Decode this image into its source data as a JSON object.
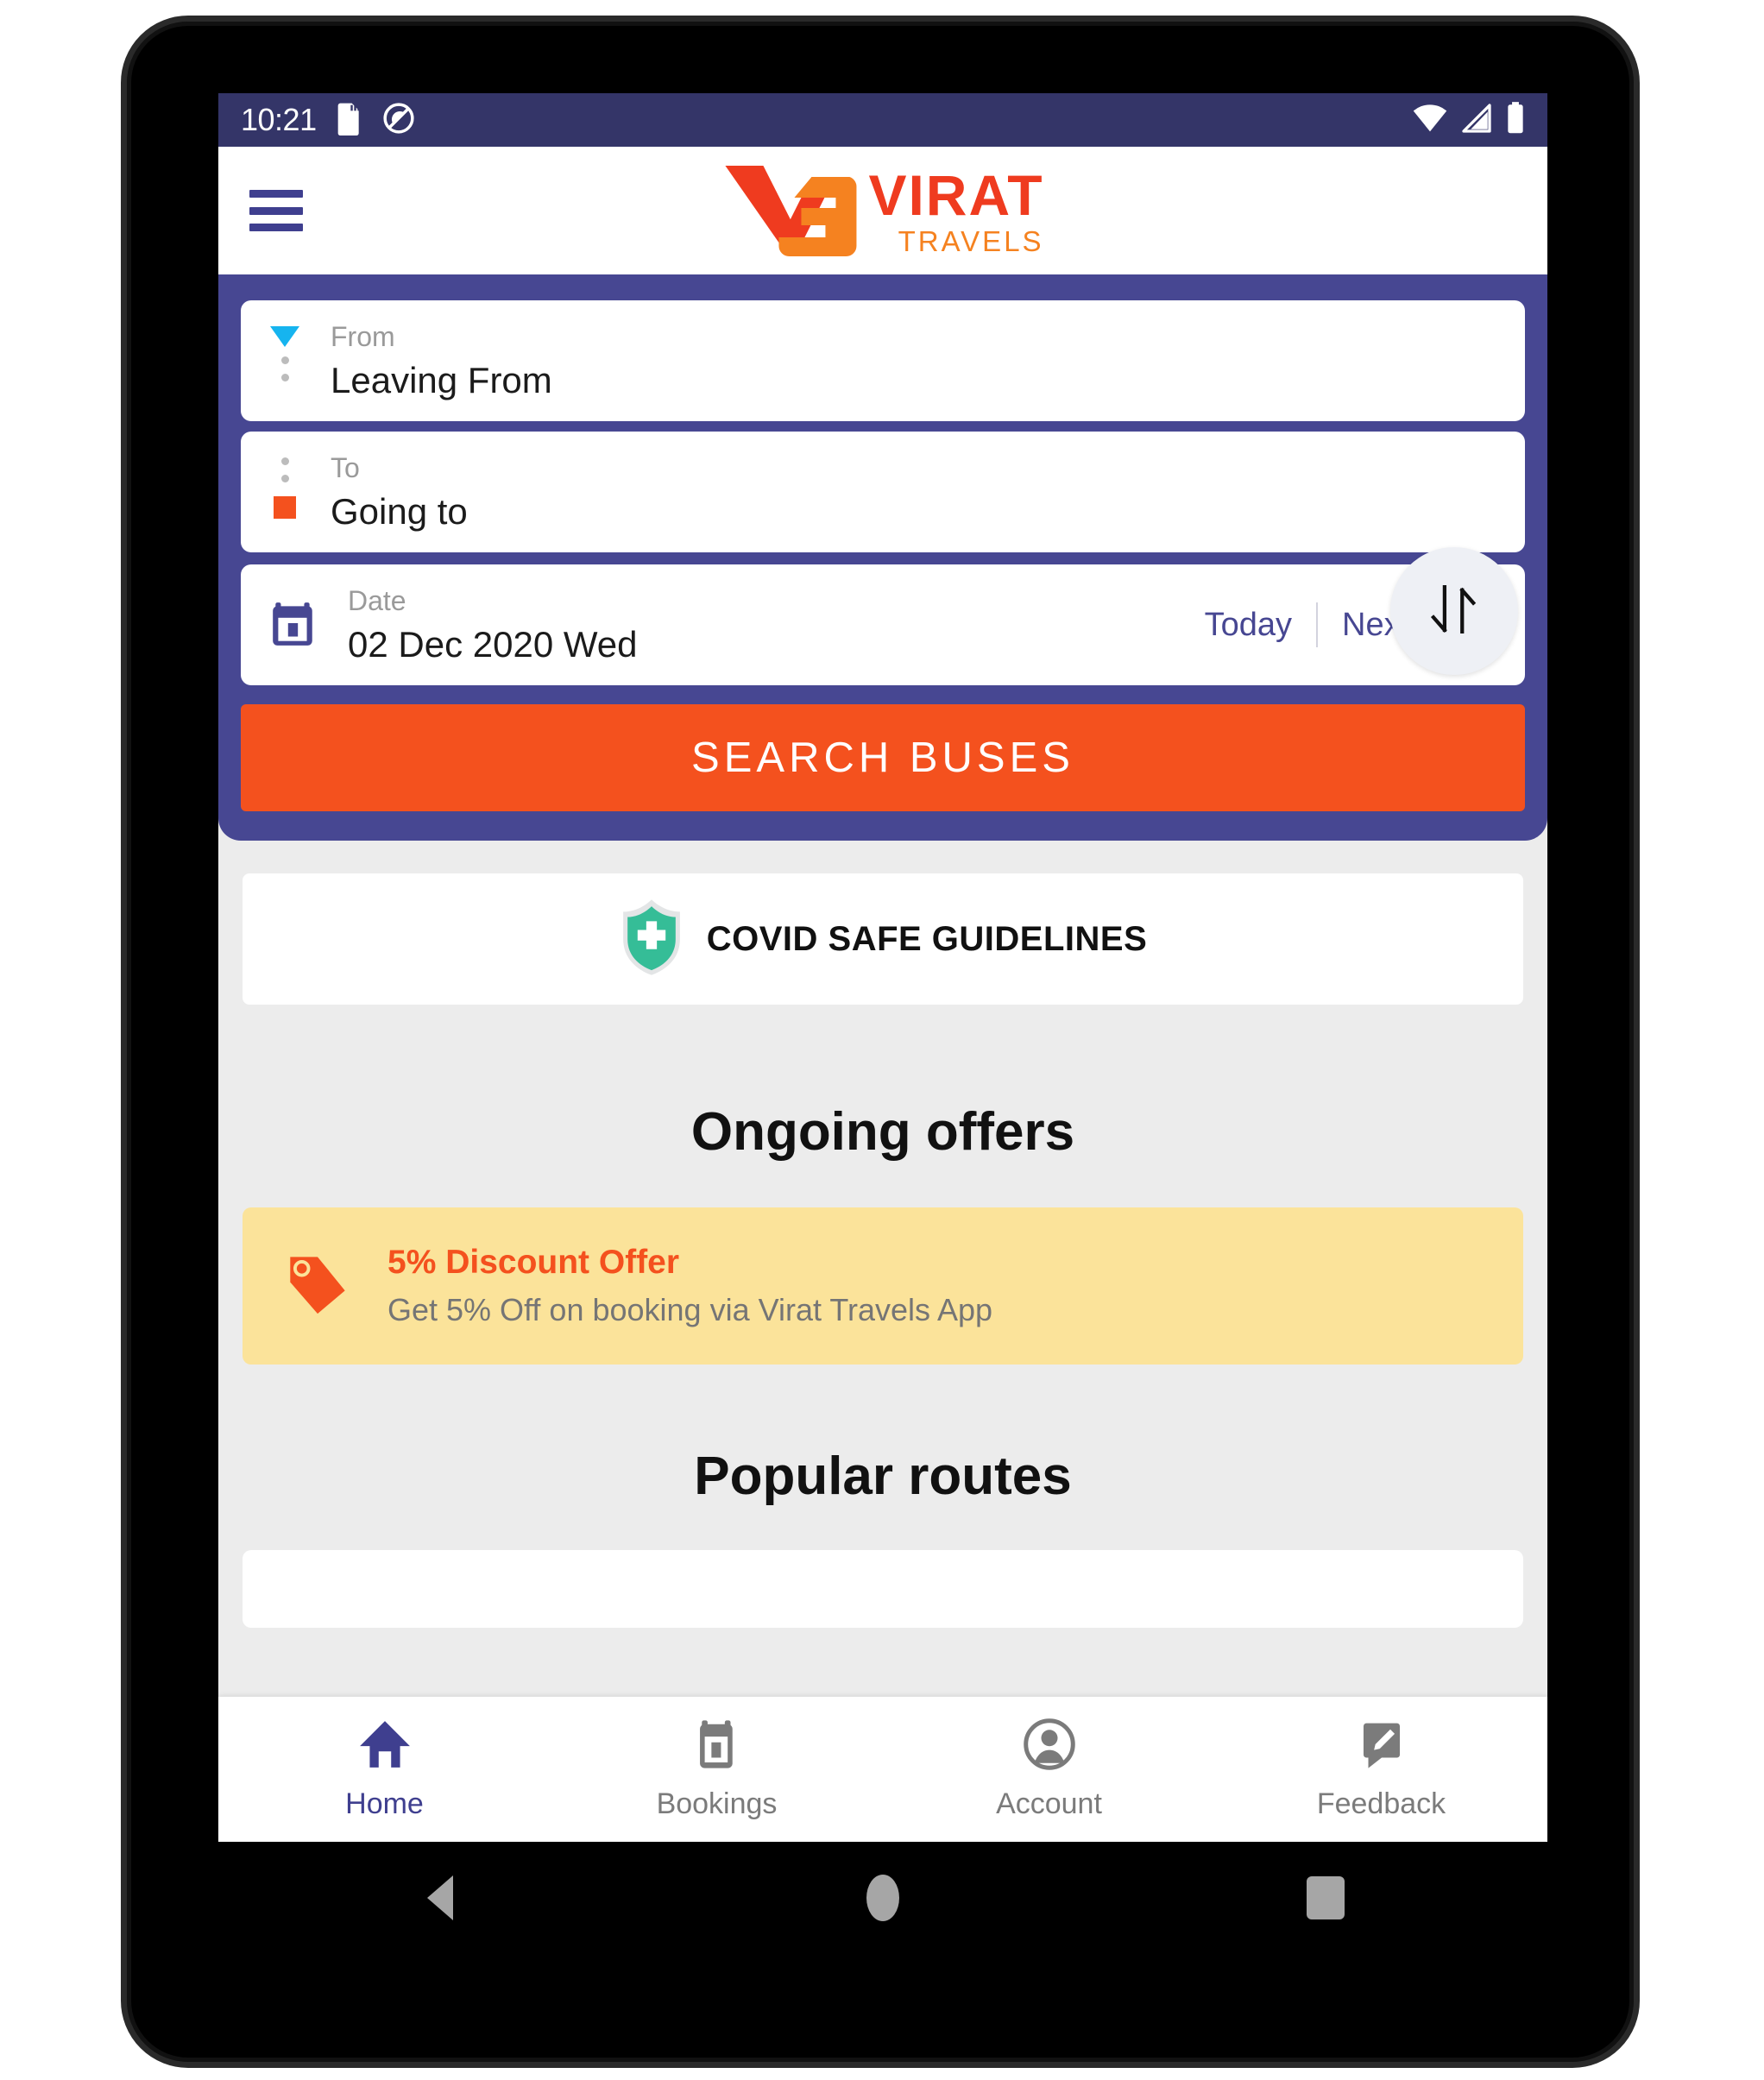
{
  "status_bar": {
    "time": "10:21",
    "icons_left": [
      "sd-card-icon",
      "do-not-disturb-icon"
    ],
    "icons_right": [
      "wifi-icon",
      "cellular-signal-icon",
      "battery-icon"
    ],
    "background": "#343568"
  },
  "app_bar": {
    "menu_icon": "hamburger-menu-icon",
    "logo": {
      "mark": "vg-monogram-icon",
      "brand": "VIRAT",
      "tagline": "TRAVELS",
      "brand_color": "#ef3b1f",
      "tagline_color": "#f58220"
    }
  },
  "search_panel": {
    "background": "#474792",
    "from": {
      "label": "From",
      "value": "Leaving From",
      "marker_color": "#16b4ef"
    },
    "to": {
      "label": "To",
      "value": "Going to",
      "marker_color": "#f4511e"
    },
    "swap_icon": "swap-vertical-arrows-icon",
    "date": {
      "label": "Date",
      "value": "02 Dec 2020 Wed",
      "icon": "calendar-icon",
      "today_label": "Today",
      "next_day_label": "Next day",
      "link_color": "#474792"
    },
    "search_button": {
      "label": "SEARCH BUSES",
      "color": "#f4511e"
    }
  },
  "content": {
    "covid_banner": {
      "label": "COVID SAFE GUIDELINES",
      "icon": "shield-plus-icon",
      "shield_color": "#35bd97"
    },
    "offers_title": "Ongoing offers",
    "offers": [
      {
        "title": "5% Discount Offer",
        "subtitle": "Get 5% Off on booking via Virat Travels App",
        "icon": "price-tag-icon",
        "background": "#fbe39a",
        "title_color": "#f4511e"
      }
    ],
    "routes_title": "Popular routes"
  },
  "bottom_nav": {
    "active_color": "#3f3f8f",
    "inactive_color": "#7b7b7b",
    "items": [
      {
        "label": "Home",
        "icon": "home-icon",
        "active": true
      },
      {
        "label": "Bookings",
        "icon": "calendar-bookings-icon",
        "active": false
      },
      {
        "label": "Account",
        "icon": "person-circle-icon",
        "active": false
      },
      {
        "label": "Feedback",
        "icon": "feedback-pencil-icon",
        "active": false
      }
    ]
  },
  "android_nav": {
    "back": "back-triangle-icon",
    "home": "home-circle-icon",
    "recents": "recents-square-icon"
  }
}
